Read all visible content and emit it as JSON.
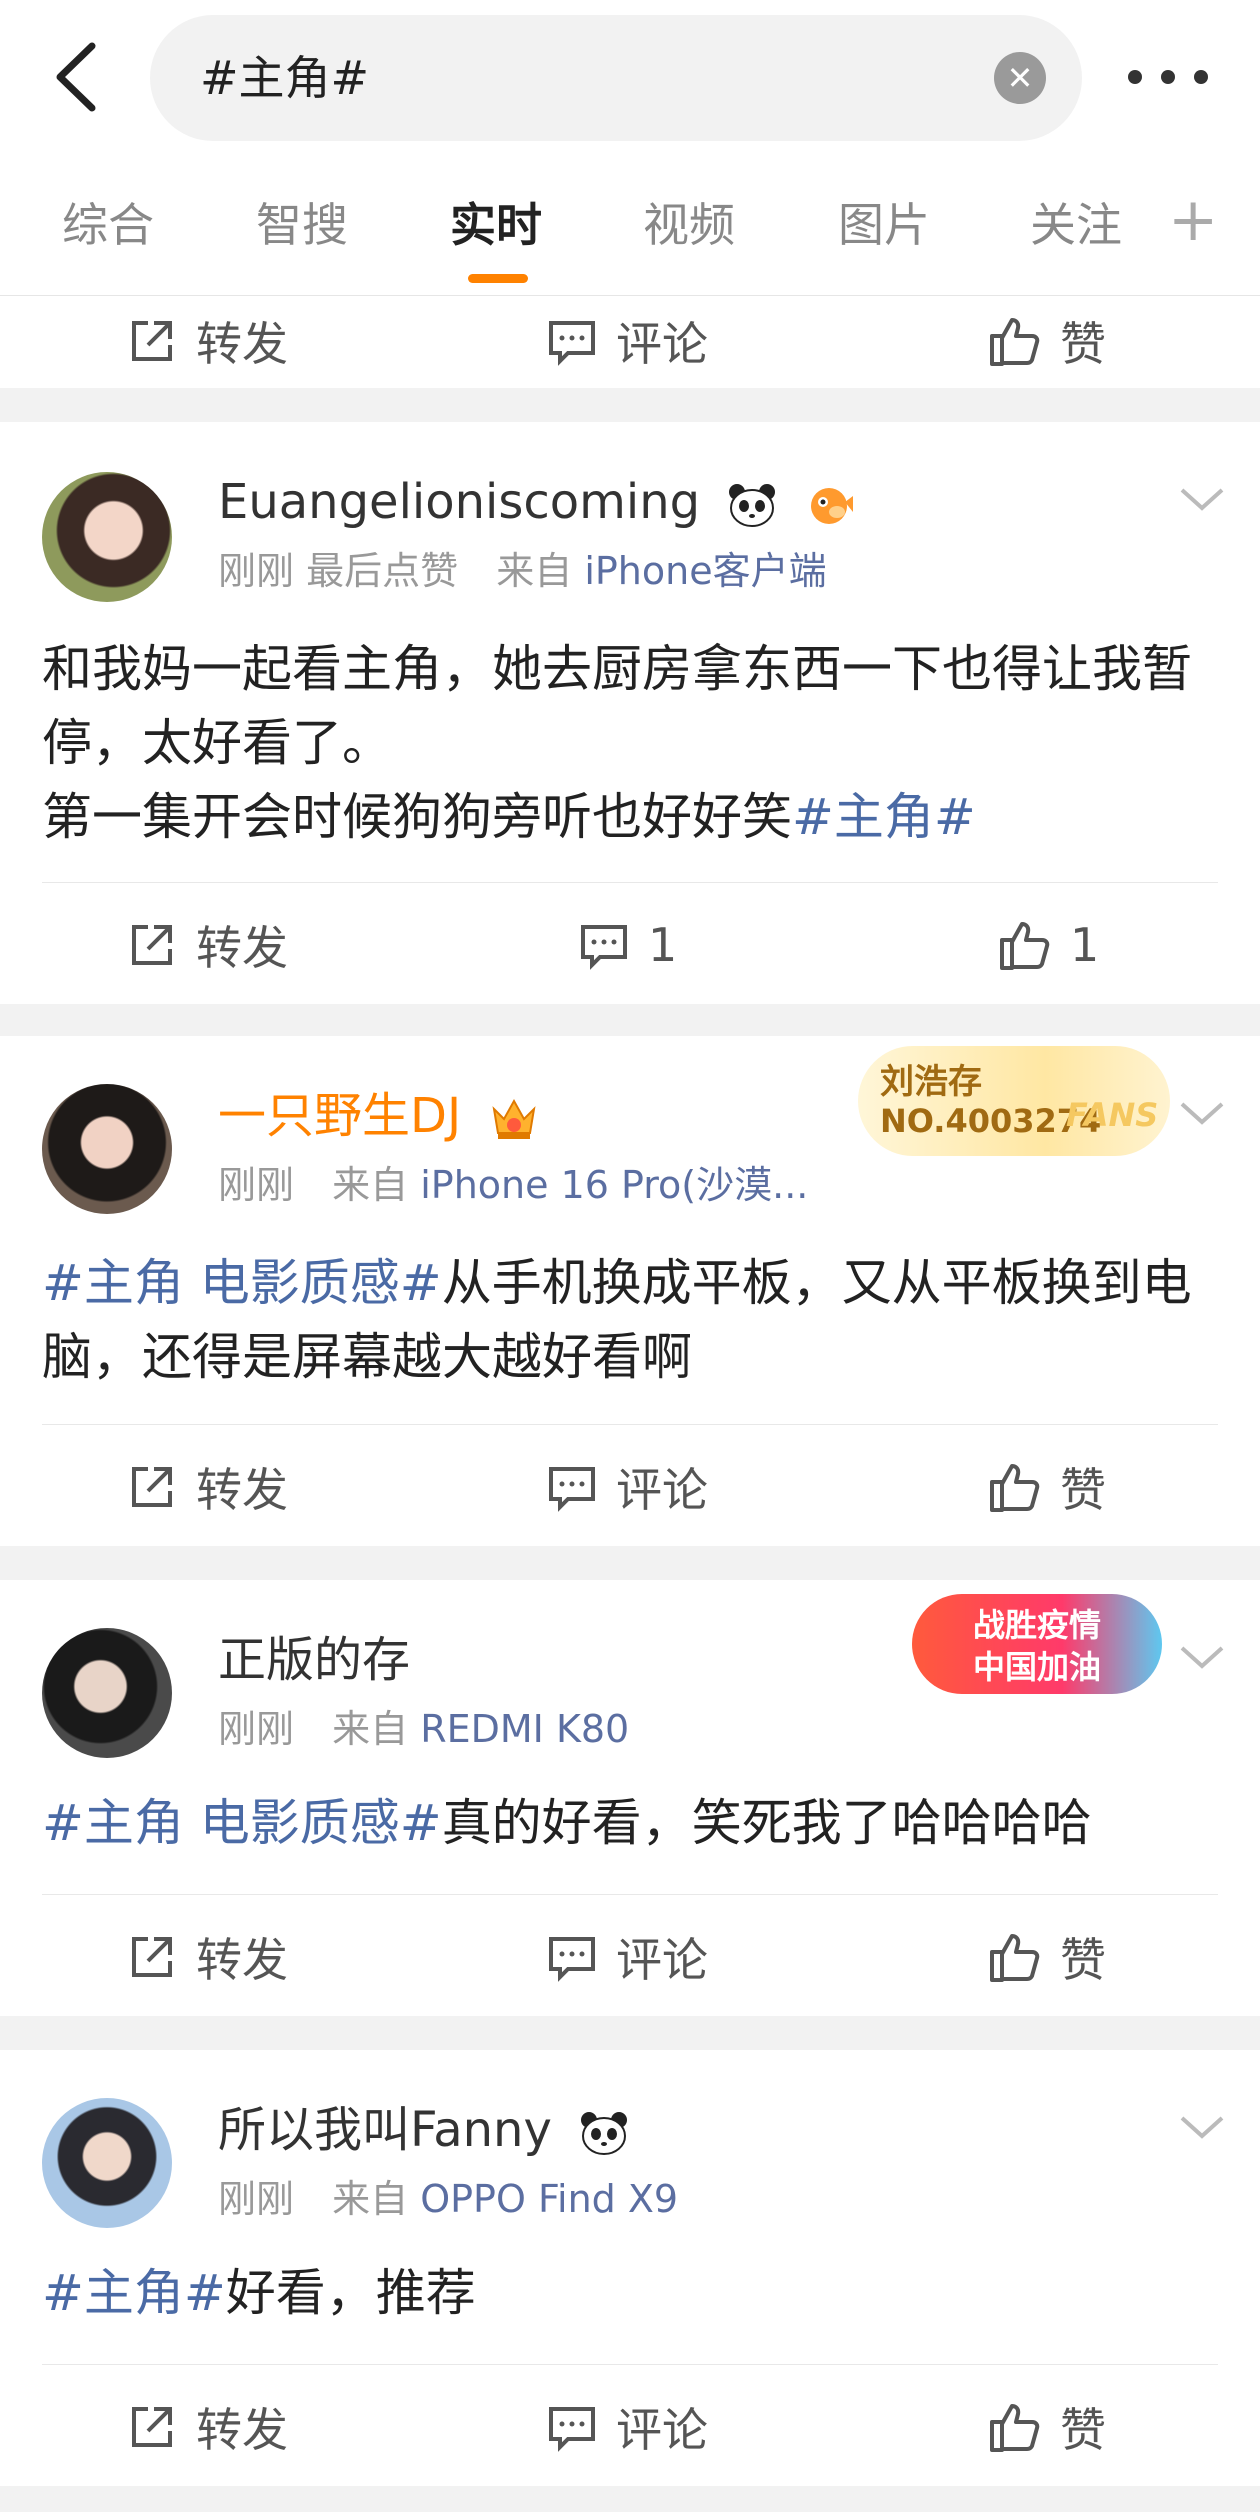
{
  "search": {
    "query": "#主角#"
  },
  "tabs": [
    {
      "label": "综合"
    },
    {
      "label": "智搜"
    },
    {
      "label": "实时"
    },
    {
      "label": "视频"
    },
    {
      "label": "图片"
    },
    {
      "label": "关注"
    }
  ],
  "prev_actions": {
    "repost": "转发",
    "comment": "评论",
    "like": "赞"
  },
  "posts": [
    {
      "user": "Euangelioniscoming",
      "meta_time": "刚刚",
      "meta_extra": "最后点赞",
      "meta_from": "来自",
      "meta_source": "iPhone客户端",
      "content_a": "和我妈一起看主角，她去厨房拿东西一下也得让我暂停，太好看了。",
      "content_b": "第一集开会时候狗狗旁听也好好笑",
      "topic": "#主角#",
      "repost": "转发",
      "comment": "1",
      "like": "1"
    },
    {
      "user": "一只野生DJ",
      "meta_time": "刚刚",
      "meta_from": "来自",
      "meta_source": "iPhone 16 Pro(沙漠...",
      "fans_name": "刘浩存",
      "fans_no": "NO.4003274",
      "fans_mark": "FANS",
      "topic": "#主角 电影质感#",
      "content": "从手机换成平板，又从平板换到电脑，还得是屏幕越大越好看啊",
      "repost": "转发",
      "comment": "评论",
      "like": "赞"
    },
    {
      "user": "正版的存",
      "meta_time": "刚刚",
      "meta_from": "来自",
      "meta_source": "REDMI K80",
      "badge_line1": "战胜疫情",
      "badge_line2": "中国加油",
      "topic": "#主角 电影质感#",
      "content": "真的好看，笑死我了哈哈哈哈",
      "repost": "转发",
      "comment": "评论",
      "like": "赞"
    },
    {
      "user": "所以我叫Fanny",
      "meta_time": "刚刚",
      "meta_from": "来自",
      "meta_source": "OPPO Find X9",
      "topic": "#主角#",
      "content": "好看，推荐",
      "repost": "转发",
      "comment": "评论",
      "like": "赞"
    }
  ],
  "colors": {
    "accent": "#ff8200",
    "topic": "#4a6aa5",
    "source": "#5b6ea1"
  }
}
